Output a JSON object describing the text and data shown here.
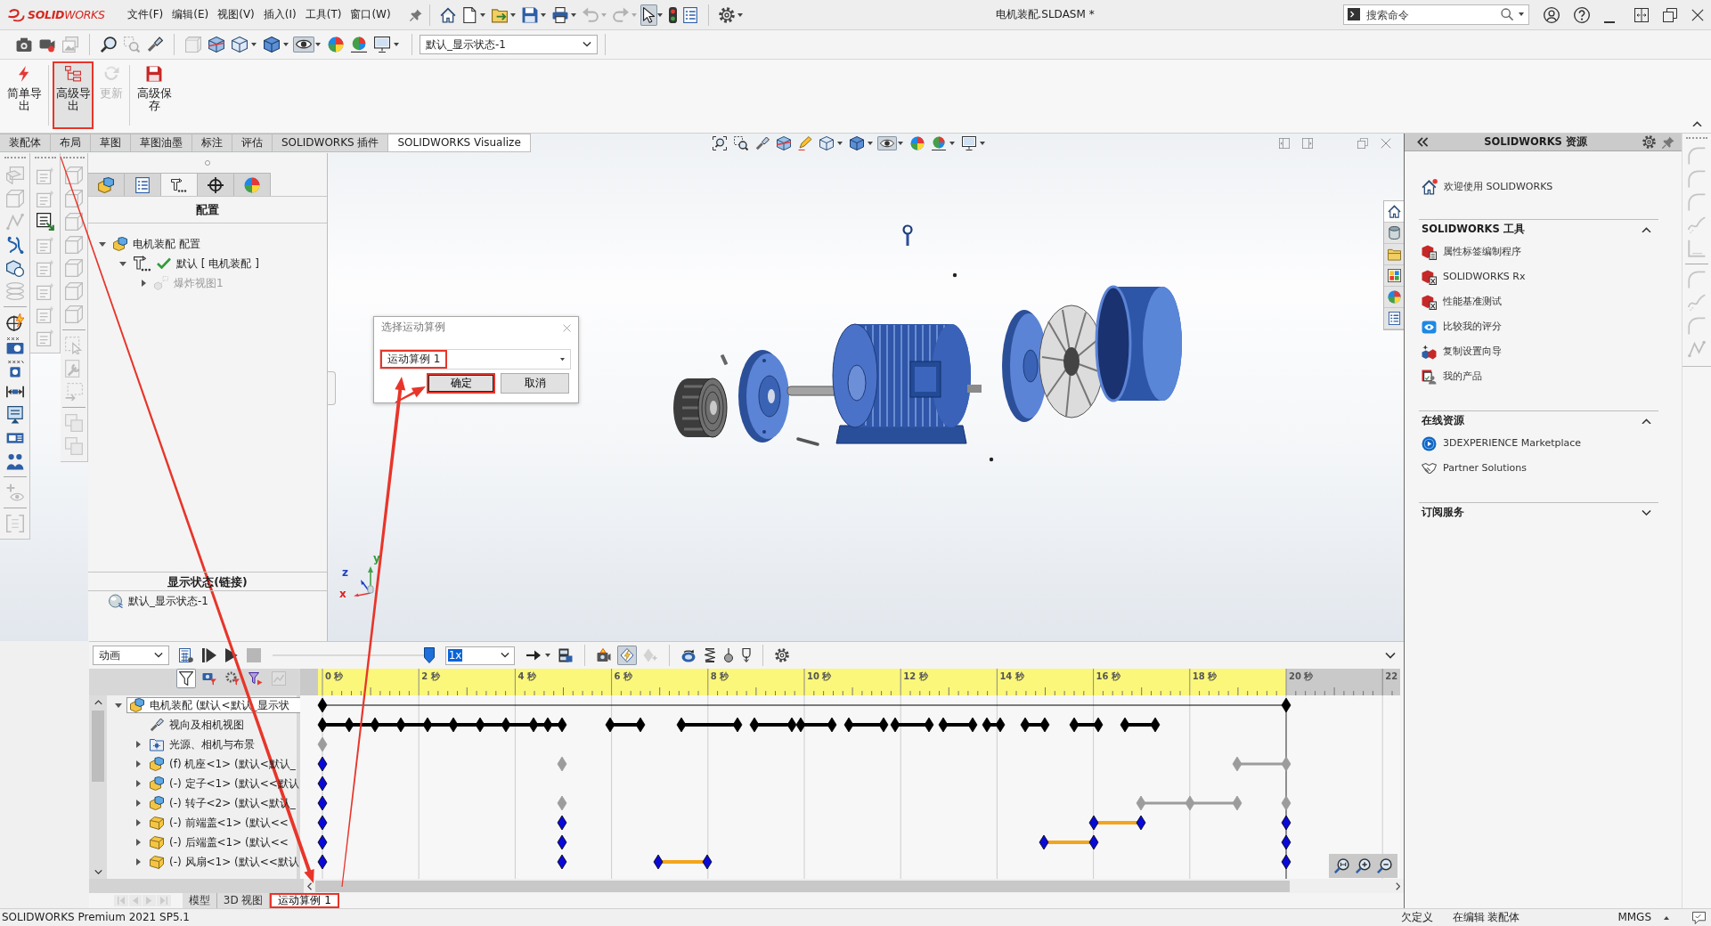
{
  "title_bar": {
    "app_name": "**SOLID**WORKS",
    "menus": [
      "文件(F)",
      "编辑(E)",
      "视图(V)",
      "插入(I)",
      "工具(T)",
      "窗口(W)"
    ],
    "quick_access": [
      {
        "pressed": false,
        "disabled": false
      },
      {
        "pressed": false,
        "disabled": false
      },
      {
        "pressed": false,
        "disabled": false
      },
      {
        "pressed": false,
        "disabled": false
      },
      {
        "pressed": false,
        "disabled": false
      },
      {
        "pressed": false,
        "disabled": true
      },
      {
        "pressed": false,
        "disabled": true
      },
      {
        "pressed": true,
        "disabled": false
      },
      {
        "pressed": false,
        "disabled": false
      },
      {
        "pressed": false,
        "disabled": false
      },
      {
        "pressed": false,
        "disabled": false
      }
    ],
    "document_title": "电机装配.SLDASM *",
    "search": {
      "placeholder": "搜索命令"
    }
  },
  "view_toolbar": {
    "buttons": [
      {
        "pressed": false,
        "disabled": false
      },
      {
        "pressed": false,
        "disabled": false
      },
      {
        "pressed": false,
        "disabled": true
      },
      {
        "pressed": false,
        "disabled": false
      },
      {
        "pressed": false,
        "disabled": true
      },
      {
        "pressed": false,
        "disabled": false
      },
      {
        "pressed": false,
        "disabled": true
      },
      {
        "pressed": false,
        "disabled": false
      },
      {
        "pressed": false,
        "disabled": false
      },
      {
        "pressed": false,
        "disabled": false
      },
      {
        "pressed": true,
        "disabled": false
      },
      {
        "pressed": false,
        "disabled": false
      },
      {
        "pressed": false,
        "disabled": false
      },
      {
        "pressed": false,
        "disabled": false
      }
    ],
    "display_state": "默认_显示状态-1"
  },
  "ribbon": {
    "buttons": [
      {
        "label": "简单导出",
        "pressed": false,
        "disabled": false,
        "highlighted": false
      },
      {
        "label": "高级导出",
        "pressed": true,
        "disabled": false,
        "highlighted": true
      },
      {
        "label": "更新",
        "pressed": false,
        "disabled": true,
        "highlighted": false
      },
      {
        "label": "高级保存",
        "pressed": false,
        "disabled": false,
        "highlighted": false
      }
    ]
  },
  "command_tabs": [
    {
      "label": "装配体",
      "selected": false
    },
    {
      "label": "布局",
      "selected": false
    },
    {
      "label": "草图",
      "selected": false
    },
    {
      "label": "草图油墨",
      "selected": false
    },
    {
      "label": "标注",
      "selected": false
    },
    {
      "label": "评估",
      "selected": false
    },
    {
      "label": "SOLIDWORKS 插件",
      "selected": false
    },
    {
      "label": "SOLIDWORKS Visualize",
      "selected": true
    }
  ],
  "heads_up_toolbar": [
    {
      "pressed": false
    },
    {
      "pressed": false
    },
    {
      "pressed": false
    },
    {
      "pressed": false
    },
    {
      "pressed": false
    },
    {
      "pressed": false
    },
    {
      "pressed": false
    },
    {
      "pressed": true
    },
    {
      "pressed": false
    },
    {
      "pressed": false
    },
    {
      "pressed": false
    }
  ],
  "side_toolbars": [
    {
      "buttons": [
        {
          "disabled": true
        },
        {
          "disabled": true
        },
        {
          "disabled": true
        },
        {
          "disabled": false
        },
        {
          "disabled": false
        },
        {
          "disabled": true
        },
        {
          "disabled": false
        },
        {
          "disabled": false
        },
        {
          "disabled": false
        },
        {
          "disabled": false
        },
        {
          "disabled": false
        },
        {
          "disabled": false
        },
        {
          "disabled": false
        },
        {
          "disabled": true
        },
        {
          "disabled": true
        }
      ]
    },
    {
      "buttons": [
        {
          "disabled": true
        },
        {
          "disabled": true
        },
        {
          "disabled": false
        },
        {
          "disabled": true
        },
        {
          "disabled": true
        },
        {
          "disabled": true
        },
        {
          "disabled": true
        },
        {
          "disabled": true
        }
      ]
    },
    {
      "buttons": [
        {
          "disabled": true
        },
        {
          "disabled": true
        },
        {
          "disabled": true
        },
        {
          "disabled": true
        },
        {
          "disabled": true
        },
        {
          "disabled": true
        },
        {
          "disabled": true
        },
        {
          "disabled": true
        },
        {
          "disabled": true
        },
        {
          "disabled": true
        },
        {
          "disabled": true
        },
        {
          "disabled": true
        }
      ]
    }
  ],
  "config_panel": {
    "tabs": [
      {
        "selected": false
      },
      {
        "selected": false
      },
      {
        "selected": true
      },
      {
        "selected": false
      },
      {
        "selected": false
      }
    ],
    "heading": "配置",
    "tree": [
      {
        "label": "电机装配 配置",
        "kind": "assembly",
        "expanded": true,
        "active": false,
        "greyed": false,
        "children": [
          {
            "label": "默认 [ 电机装配 ]",
            "kind": "configuration",
            "expanded": true,
            "active": true,
            "greyed": false,
            "children": [
              {
                "label": "爆炸视图1",
                "kind": "explode",
                "expanded": false,
                "active": false,
                "greyed": true
              }
            ]
          }
        ]
      }
    ],
    "display_states": {
      "heading": "显示状态(链接)",
      "items": [
        "默认_显示状态-1"
      ]
    }
  },
  "viewport": {
    "axes": [
      {
        "label": "x",
        "color": "#e02020"
      },
      {
        "label": "y",
        "color": "#2e9d3a"
      },
      {
        "label": "z",
        "color": "#2040c0"
      }
    ]
  },
  "dialog": {
    "title": "选择运动算例",
    "study": {
      "value": "运动算例 1",
      "highlighted": true
    },
    "buttons": [
      {
        "label": "确定",
        "default": true,
        "highlighted": true
      },
      {
        "label": "取消",
        "default": false,
        "highlighted": false
      }
    ]
  },
  "task_pane": {
    "tabs": [
      {
        "selected": true
      },
      {
        "selected": false
      },
      {
        "selected": false
      },
      {
        "selected": false
      },
      {
        "selected": false
      },
      {
        "selected": false
      }
    ],
    "title": "SOLIDWORKS 资源",
    "welcome": "欢迎使用 SOLIDWORKS",
    "sections": [
      {
        "title": "SOLIDWORKS 工具",
        "expanded": true,
        "items": [
          "属性标签编制程序",
          "SOLIDWORKS Rx",
          "性能基准测试",
          "比较我的评分",
          "复制设置向导",
          "我的产品"
        ]
      },
      {
        "title": "在线资源",
        "expanded": true,
        "items": [
          "3DEXPERIENCE Marketplace",
          "Partner Solutions"
        ]
      },
      {
        "title": "订阅服务",
        "expanded": false
      }
    ]
  },
  "right_toolbar": {
    "buttons": [
      {
        "disabled": true
      },
      {
        "disabled": true
      },
      {
        "disabled": true
      },
      {
        "disabled": true
      },
      {
        "disabled": true
      },
      {
        "disabled": true
      },
      {
        "disabled": true
      },
      {
        "disabled": true
      },
      {
        "disabled": true
      }
    ]
  },
  "motion_study": {
    "toolbar": {
      "study_type": "动画",
      "playback_speed": "1x",
      "slider": {
        "level": 1
      },
      "buttons": [
        {
          "pressed": false,
          "disabled": false
        },
        {
          "pressed": false,
          "disabled": false
        },
        {
          "pressed": false,
          "disabled": false
        },
        {
          "pressed": false,
          "disabled": true
        },
        {
          "pressed": false,
          "disabled": false
        },
        {
          "pressed": false,
          "disabled": false
        },
        {
          "pressed": false,
          "disabled": false
        },
        {
          "pressed": true,
          "disabled": false
        },
        {
          "pressed": false,
          "disabled": true
        },
        {
          "pressed": false,
          "disabled": false
        },
        {
          "pressed": false,
          "disabled": false
        },
        {
          "pressed": false,
          "disabled": false
        },
        {
          "pressed": false,
          "disabled": false
        },
        {
          "pressed": false,
          "disabled": false
        }
      ]
    },
    "filters": [
      {
        "pressed": true,
        "disabled": false
      },
      {
        "pressed": false,
        "disabled": false
      },
      {
        "pressed": false,
        "disabled": false
      },
      {
        "pressed": false,
        "disabled": false
      },
      {
        "pressed": false,
        "disabled": true
      }
    ],
    "tree": [
      {
        "label": "电机装配 (默认<默认_显示状",
        "kind": "assembly",
        "expanded": true,
        "selected": true,
        "children": [
          {
            "label": "视向及相机视图",
            "kind": "camera",
            "selected": false
          },
          {
            "label": "光源、相机与布景",
            "kind": "scene",
            "expanded": false,
            "selected": false
          },
          {
            "label": "(f) 机座<1> (默认<默认_",
            "kind": "assembly",
            "expanded": false,
            "selected": false
          },
          {
            "label": "(-) 定子<1> (默认<<默认",
            "kind": "assembly",
            "expanded": false,
            "selected": false
          },
          {
            "label": "(-) 转子<2> (默认<默认_",
            "kind": "assembly",
            "expanded": false,
            "selected": false
          },
          {
            "label": "(-) 前端盖<1> (默认<<",
            "kind": "part",
            "expanded": false,
            "selected": false
          },
          {
            "label": "(-) 后端盖<1> (默认<<",
            "kind": "part",
            "expanded": false,
            "selected": false
          },
          {
            "label": "(-) 风扇<1> (默认<<默认",
            "kind": "part",
            "expanded": false,
            "selected": false
          }
        ]
      }
    ],
    "ruler": [
      "0 秒",
      "2 秒",
      "4 秒",
      "6 秒",
      "8 秒",
      "10 秒",
      "12 秒",
      "14 秒",
      "16 秒",
      "18 秒",
      "20 秒",
      "22"
    ],
    "tab_scroll": [
      {
        "disabled": true
      },
      {
        "disabled": true
      },
      {
        "disabled": true
      },
      {
        "disabled": true
      }
    ],
    "tabs": [
      {
        "label": "模型",
        "selected": false,
        "highlighted": false
      },
      {
        "label": "3D 视图",
        "selected": false,
        "highlighted": false
      },
      {
        "label": "运动算例 1",
        "selected": true,
        "highlighted": true
      }
    ]
  },
  "status_bar": {
    "product": "SOLIDWORKS Premium 2021 SP5.1",
    "definition": "欠定义",
    "mode": "在编辑 装配体",
    "units": "MMGS"
  }
}
